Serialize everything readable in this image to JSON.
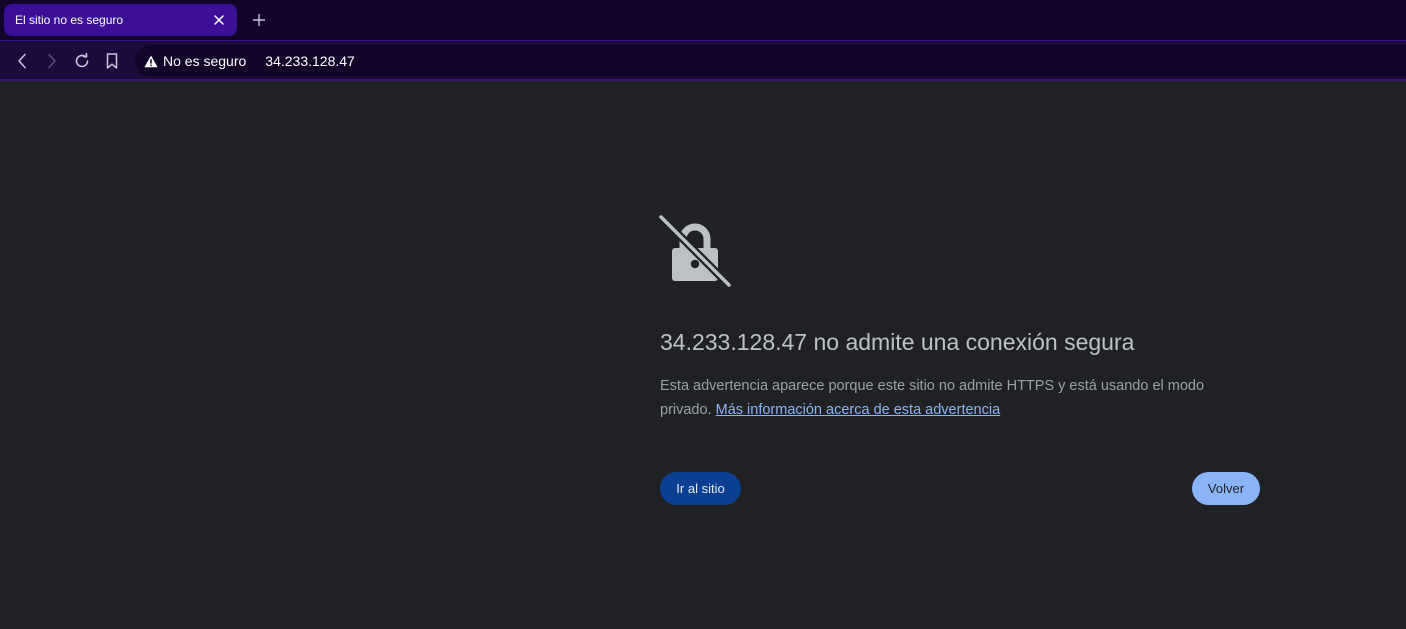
{
  "browser": {
    "tab": {
      "title": "El sitio no es seguro",
      "close_icon": "close-icon"
    },
    "new_tab_icon": "plus-icon",
    "toolbar": {
      "back_icon": "chevron-left-icon",
      "forward_icon": "chevron-right-icon",
      "reload_icon": "reload-icon",
      "bookmark_icon": "bookmark-icon"
    },
    "omnibox": {
      "security_icon": "warning-triangle-icon",
      "security_label": "No es seguro",
      "url": "34.233.128.47"
    }
  },
  "interstitial": {
    "icon": "lock-crossed-icon",
    "heading": "34.233.128.47 no admite una conexión segura",
    "body": "Esta advertencia aparece porque este sitio no admite HTTPS y está usando el modo privado.",
    "learn_more_link": "Más información acerca de esta advertencia",
    "proceed_button": "Ir al sitio",
    "back_button": "Volver"
  },
  "colors": {
    "tabstrip_bg": "#13042a",
    "active_tab_bg": "#3b0f96",
    "page_bg": "#202124",
    "heading_text": "#bdc1c6",
    "body_text": "#9aa0a6",
    "link": "#8ab4f8",
    "proceed_button_bg": "#0b3f94",
    "back_button_bg": "#8ab4f8"
  }
}
